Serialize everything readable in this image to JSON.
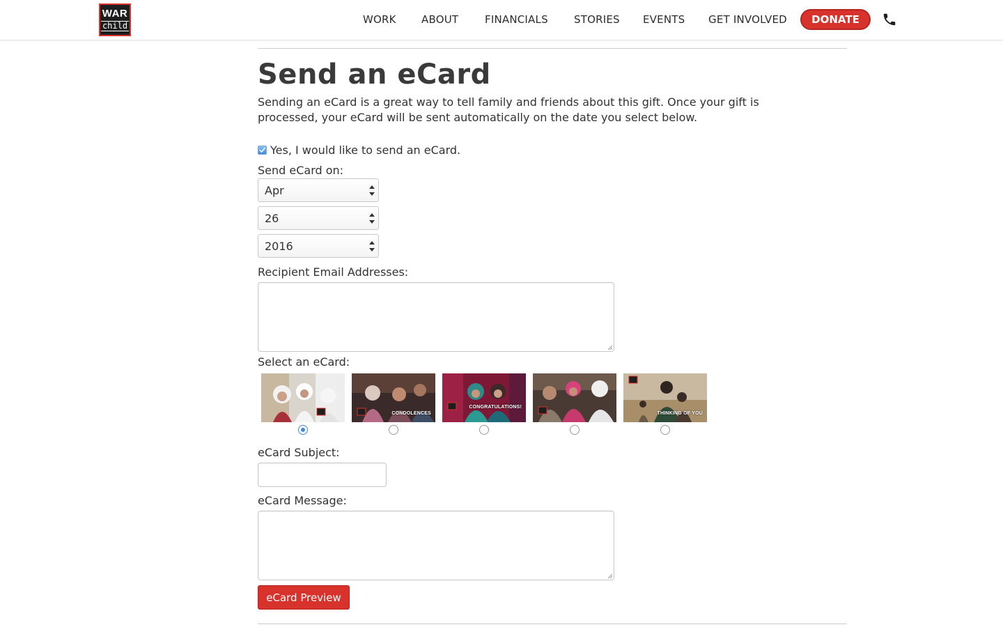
{
  "brand": {
    "logo_top": "WAR",
    "logo_bottom": "child",
    "accent": "#d7322b"
  },
  "nav": {
    "items": [
      {
        "label": "WORK"
      },
      {
        "label": "ABOUT"
      },
      {
        "label": "FINANCIALS"
      },
      {
        "label": "STORIES"
      },
      {
        "label": "EVENTS"
      },
      {
        "label": "GET INVOLVED"
      }
    ],
    "donate_label": "DONATE",
    "phone_icon": "phone-icon"
  },
  "page": {
    "title": "Send an eCard",
    "intro": "Sending an eCard is a great way to tell family and friends about this gift. Once your gift is processed, your eCard will be sent automatically on the date you select below."
  },
  "form": {
    "send_ecard_checkbox": {
      "label": "Yes, I would like to send an eCard.",
      "checked": true
    },
    "send_on_label": "Send eCard on:",
    "month": {
      "value": "Apr"
    },
    "day": {
      "value": "26"
    },
    "year": {
      "value": "2016"
    },
    "recipients_label": "Recipient Email Addresses:",
    "recipients_value": "",
    "select_ecard_label": "Select an eCard:",
    "ecards": [
      {
        "caption": "",
        "selected": true
      },
      {
        "caption": "CONDOLENCES",
        "selected": false
      },
      {
        "caption": "CONGRATULATIONS!",
        "selected": false
      },
      {
        "caption": "",
        "selected": false
      },
      {
        "caption": "THINKING OF YOU",
        "selected": false
      }
    ],
    "subject_label": "eCard Subject:",
    "subject_value": "",
    "message_label": "eCard Message:",
    "message_value": "",
    "preview_button": "eCard Preview"
  }
}
